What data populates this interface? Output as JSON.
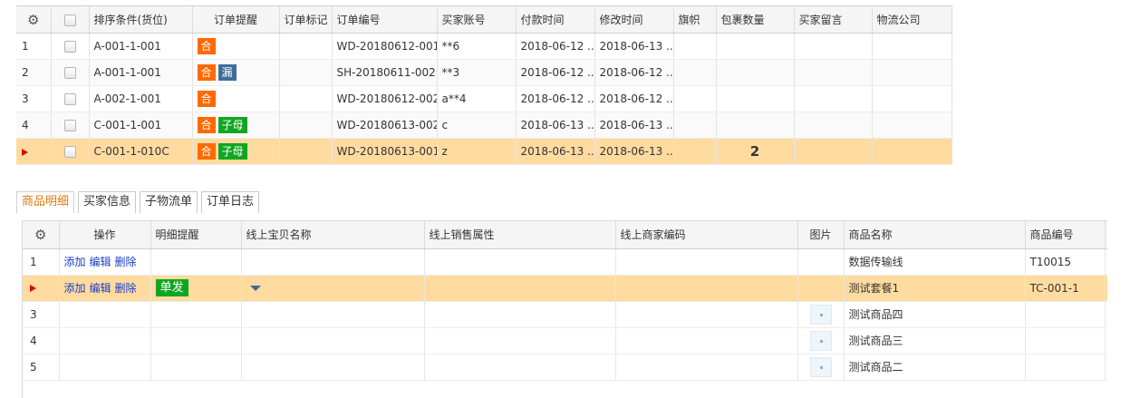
{
  "orders": {
    "columns": [
      "排序条件(货位)",
      "订单提醒",
      "订单标记",
      "订单编号",
      "买家账号",
      "付款时间",
      "修改时间",
      "旗帜",
      "包裹数量",
      "买家留言",
      "物流公司"
    ],
    "rows": [
      {
        "num": "1",
        "location": "A-001-1-001",
        "tags": [
          {
            "text": "合",
            "color": "orange"
          }
        ],
        "mark": "",
        "order_no": "WD-20180612-001",
        "buyer": "**6",
        "paid": "2018-06-12 ...",
        "modified": "2018-06-13 ...",
        "flag": "",
        "qty": "",
        "note": "",
        "carrier": ""
      },
      {
        "num": "2",
        "location": "A-001-1-001",
        "tags": [
          {
            "text": "合",
            "color": "orange"
          },
          {
            "text": "漏",
            "color": "blue"
          }
        ],
        "mark": "",
        "order_no": "SH-20180611-002",
        "buyer": "**3",
        "paid": "2018-06-12 ...",
        "modified": "2018-06-12 ...",
        "flag": "",
        "qty": "",
        "note": "",
        "carrier": ""
      },
      {
        "num": "3",
        "location": "A-002-1-001",
        "tags": [
          {
            "text": "合",
            "color": "orange"
          }
        ],
        "mark": "",
        "order_no": "WD-20180612-002",
        "buyer": "a**4",
        "paid": "2018-06-12 ...",
        "modified": "2018-06-12 ...",
        "flag": "",
        "qty": "",
        "note": "",
        "carrier": ""
      },
      {
        "num": "4",
        "location": "C-001-1-001",
        "tags": [
          {
            "text": "合",
            "color": "orange"
          },
          {
            "text": "子母",
            "color": "green"
          }
        ],
        "mark": "",
        "order_no": "WD-20180613-002",
        "buyer": "c",
        "paid": "2018-06-13 ...",
        "modified": "2018-06-13 ...",
        "flag": "",
        "qty": "",
        "note": "",
        "carrier": ""
      },
      {
        "num": "",
        "location": "C-001-1-010C",
        "tags": [
          {
            "text": "合",
            "color": "orange"
          },
          {
            "text": "子母",
            "color": "green"
          }
        ],
        "mark": "",
        "order_no": "WD-20180613-001",
        "buyer": "z",
        "paid": "2018-06-13 ...",
        "modified": "2018-06-13 ...",
        "flag": "",
        "qty": "2",
        "note": "",
        "carrier": ""
      }
    ]
  },
  "tabs": [
    "商品明细",
    "买家信息",
    "子物流单",
    "订单日志"
  ],
  "items": {
    "columns": [
      "操作",
      "明细提醒",
      "线上宝贝名称",
      "线上销售属性",
      "线上商家编码",
      "图片",
      "商品名称",
      "商品编号"
    ],
    "actions": [
      "添加",
      "编辑",
      "删除"
    ],
    "rows": [
      {
        "num": "1",
        "has_actions": true,
        "remind": "",
        "has_dropdown": false,
        "has_thumb": false,
        "product": "数据传输线",
        "code": "T10015"
      },
      {
        "num": "",
        "has_actions": true,
        "remind": "单发",
        "has_dropdown": true,
        "has_thumb": false,
        "product": "测试套餐1",
        "code": "TC-001-1"
      },
      {
        "num": "3",
        "has_actions": false,
        "remind": "",
        "has_dropdown": false,
        "has_thumb": true,
        "product": "测试商品四",
        "code": ""
      },
      {
        "num": "4",
        "has_actions": false,
        "remind": "",
        "has_dropdown": false,
        "has_thumb": true,
        "product": "测试商品三",
        "code": ""
      },
      {
        "num": "5",
        "has_actions": false,
        "remind": "",
        "has_dropdown": false,
        "has_thumb": true,
        "product": "测试商品二",
        "code": ""
      }
    ]
  },
  "colors": {
    "accent_orange": "#ff6a00",
    "tag_blue": "#3f6e9b",
    "tag_green": "#11a622",
    "selected_row": "#ffdba0",
    "link_blue": "#1a3cc8",
    "row_marker": "#e00000"
  },
  "icons": {
    "settings": "gear-icon",
    "current_row": "triangle-right-icon",
    "dropdown": "caret-down-icon"
  }
}
